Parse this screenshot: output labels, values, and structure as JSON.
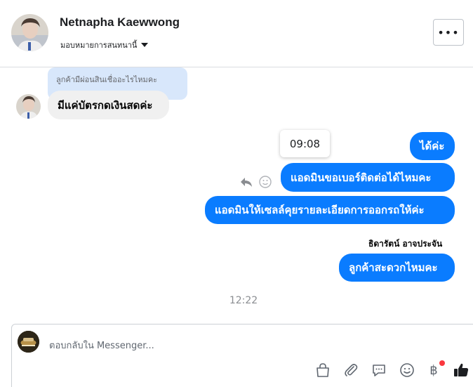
{
  "header": {
    "contact_name": "Netnapha Kaewwong",
    "assign_label": "มอบหมายการสนทนานี้",
    "more_label": "•••"
  },
  "conversation": {
    "quoted_text": "ลูกค้ามีผ่อนสินเชื่ออะไรไหมคะ",
    "incoming": [
      {
        "text": "มีแค่บัตรกดเงินสดค่ะ"
      }
    ],
    "outgoing_group_1": [
      {
        "text": "ได้ค่ะ"
      },
      {
        "text": "แอดมินขอเบอร์ติดต่อได้ไหมคะ"
      },
      {
        "text": "แอดมินให้เซลล์คุยรายละเอียดการออกรถให้ค่ะ"
      }
    ],
    "tooltip_time": "09:08",
    "sender_name": "ธิดารัตน์ อาจประจัน",
    "outgoing_group_2": [
      {
        "text": "ลูกค้าสะดวกไหมคะ"
      }
    ],
    "divider_time": "12:22"
  },
  "composer": {
    "placeholder": "ตอบกลับใน Messenger...",
    "value": "",
    "tools": [
      "gift-bag-icon",
      "paperclip-icon",
      "quick-reply-icon",
      "emoji-icon",
      "baht-payment-icon",
      "like-icon"
    ],
    "baht_symbol": "฿"
  },
  "colors": {
    "outgoing_bubble": "#0a7cff",
    "incoming_bubble": "#f0f0f0",
    "quote_bubble": "#d8e7fb",
    "notification_dot": "#fa383e"
  }
}
